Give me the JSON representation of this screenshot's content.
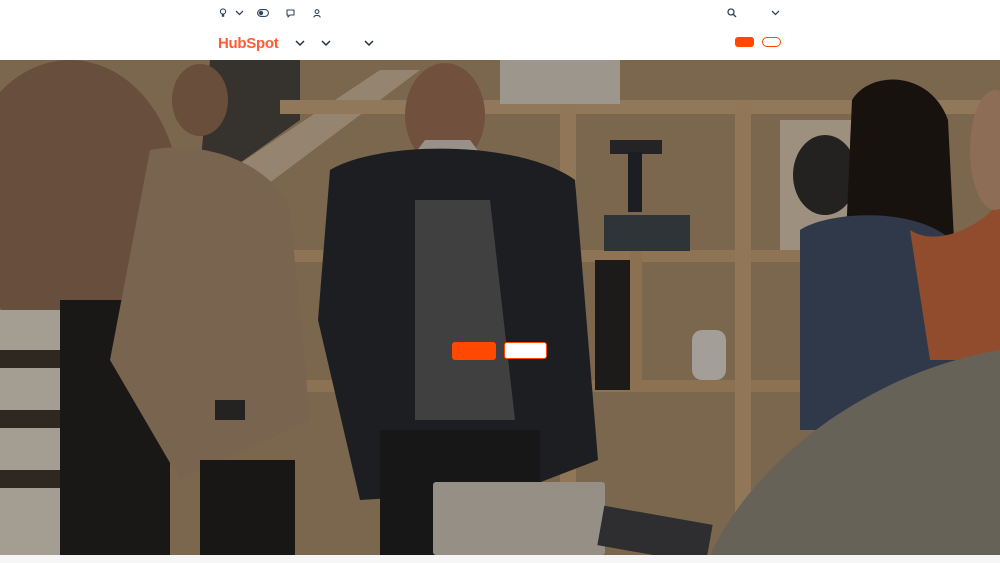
{
  "brand": {
    "logo_text": "HubSpot",
    "accent_color": "#ff4800",
    "logo_color": "#ff5c35"
  },
  "utility_bar": {
    "icons": [
      "lightbulb-icon",
      "chevron-down-icon",
      "toggle-icon",
      "chat-icon",
      "person-icon",
      "search-icon",
      "chevron-down-icon"
    ]
  },
  "main_nav": {
    "menus": [
      "chevron-down-icon",
      "chevron-down-icon",
      "chevron-down-icon"
    ],
    "buttons": [
      {
        "style": "primary",
        "color": "#ff4800"
      },
      {
        "style": "secondary-outline",
        "color": "#ff4800"
      }
    ]
  },
  "hero": {
    "ctas": [
      {
        "style": "primary",
        "color": "#ff4800"
      },
      {
        "style": "secondary-outline",
        "color": "#ffffff"
      }
    ]
  }
}
